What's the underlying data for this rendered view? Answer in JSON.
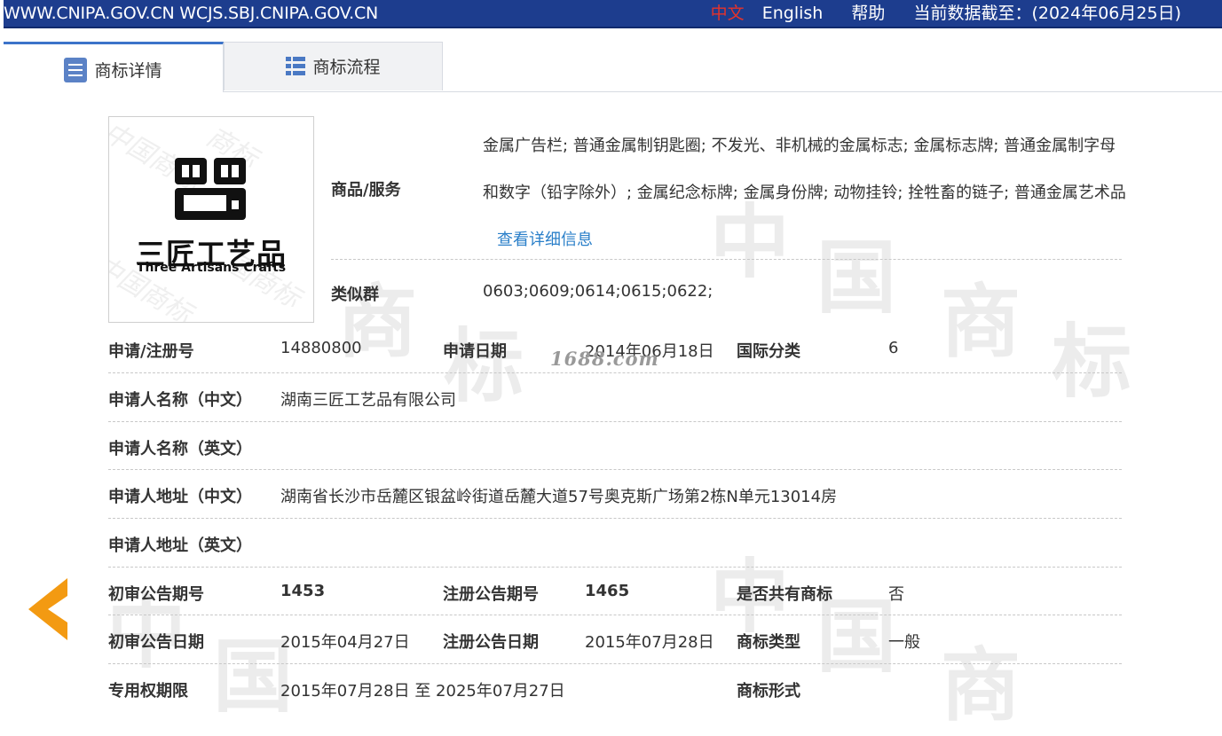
{
  "topbar": {
    "site": "WWW.CNIPA.GOV.CN WCJS.SBJ.CNIPA.GOV.CN",
    "lang_cn": "中文",
    "lang_en": "English",
    "help": "帮助",
    "data_date": "当前数据截至：(2024年06月25日)"
  },
  "tabs": [
    {
      "label": "商标详情",
      "icon": "document-icon",
      "active": true
    },
    {
      "label": "商标流程",
      "icon": "list-icon",
      "active": false
    }
  ],
  "logo": {
    "name_cn": "三匠工艺品",
    "name_en": "Three Artisans Crafts"
  },
  "goods": {
    "label": "商品/服务",
    "value": "金属广告栏; 普通金属制钥匙圈; 不发光、非机械的金属标志; 金属标志牌; 普通金属制字母和数字（铅字除外）; 金属纪念标牌; 金属身份牌; 动物挂铃; 拴牲畜的链子; 普通金属艺术品",
    "link": "查看详细信息"
  },
  "similar_group": {
    "label": "类似群",
    "value": "0603;0609;0614;0615;0622;"
  },
  "rows": {
    "reg_no_label": "申请/注册号",
    "reg_no": "14880800",
    "apply_date_label": "申请日期",
    "apply_date": "2014年06月18日",
    "intl_class_label": "国际分类",
    "intl_class": "6",
    "applicant_cn_label": "申请人名称（中文）",
    "applicant_cn": "湖南三匠工艺品有限公司",
    "applicant_en_label": "申请人名称（英文）",
    "applicant_en": "",
    "address_cn_label": "申请人地址（中文）",
    "address_cn": "湖南省长沙市岳麓区银盆岭街道岳麓大道57号奥克斯广场第2栋N单元13014房",
    "address_en_label": "申请人地址（英文）",
    "address_en": "",
    "prelim_issue_label": "初审公告期号",
    "prelim_issue": "1453",
    "reg_issue_label": "注册公告期号",
    "reg_issue": "1465",
    "shared_label": "是否共有商标",
    "shared": "否",
    "prelim_date_label": "初审公告日期",
    "prelim_date": "2015年04月27日",
    "reg_date_label": "注册公告日期",
    "reg_date": "2015年07月28日",
    "type_label": "商标类型",
    "type": "一般",
    "term_label": "专用权期限",
    "term": "2015年07月28日 至 2025年07月27日",
    "form_label": "商标形式",
    "form": ""
  },
  "watermark": {
    "stamp": "1688.com",
    "chars": [
      "中",
      "国",
      "商",
      "标"
    ]
  },
  "nav": {
    "prev_icon": "chevron-left-icon"
  },
  "colors": {
    "topbar": "#1d3d8e",
    "accent": "#3c73c9",
    "link": "#2a7fc9",
    "arrow": "#f39a12"
  }
}
